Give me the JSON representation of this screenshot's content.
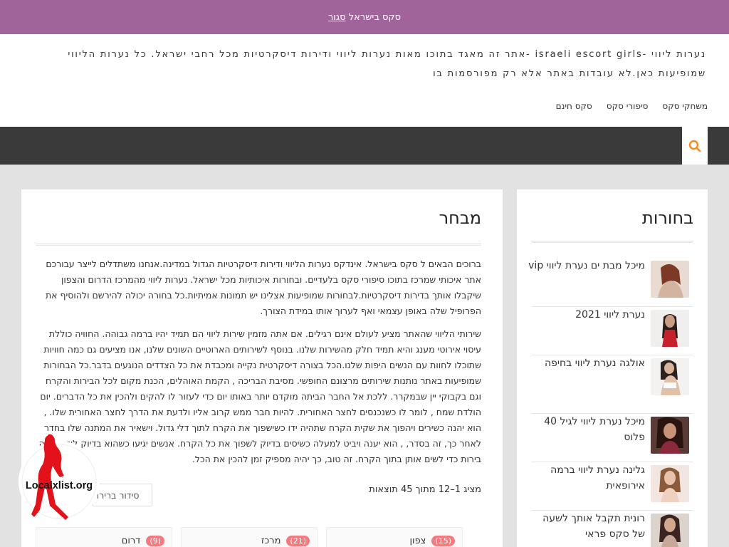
{
  "notice": {
    "text": "סקס בישראל",
    "close_label": "סגור"
  },
  "header": {
    "description": "נערות ליווי -israeli escort girls -אתר זה מאגד בתוכו מאות נערות ליווי ודירות דיסקרטיות מכל רחבי ישראל. כל נערות הליווי שמופיעות כאן.לא עובדות באתר אלא רק מפורסמות בו",
    "menu": [
      "משחקי סקס",
      "סיפורי סקס",
      "סקס חינם"
    ]
  },
  "colors": {
    "notice_bg": "#a0649b",
    "nav_bg": "#3a3a3a",
    "accent": "#f58a1f",
    "badge": "#f37a7f"
  },
  "icons": {
    "search": "search-icon"
  },
  "sidebar": {
    "title": "בחורות",
    "items": [
      {
        "label": "מיכל מבת ים נערת ליווי vip"
      },
      {
        "label": "נערת ליווי 2021"
      },
      {
        "label": "אולגה נערת ליווי בחיפה"
      },
      {
        "label": "מיכל נערת ליווי לגיל 40 פלוס"
      },
      {
        "label": "גלינה נערת ליווי ברמה אירופאית"
      },
      {
        "label": "רונית תקבל אותך לשעה של סקס פראי"
      }
    ]
  },
  "main": {
    "title": "מבחר",
    "para1": "ברוכים הבאים ל סקס בישראל. אינדקס נערות הליווי ודירות דיסקרטיות הגדול במדינה.אנחנו משתדלים לייצר עבורכם אתר איכותי שמרכז בתוכו סיפורי סקס בלעדיים. ובחורות איכותיות מכל ישראל. נערות ליווי מהמרכז הדרום והצפון שיקבלו אותך בדירות דיסקרטיות.לבחורות שמופיעות אצלינו יש תמונות אמיתיות.כל בחורה יכולה להירשם ולהוסיף את הפרופיל שלה באופן עצמאי ואף לערוך אותו במידת הצורך.",
    "para2": "שירותי הליווי שהאתר מציע  לעולם אינם רגילים. אם אתה מזמין שירות ליווי הם תמיד יהיו ברמה גבוהה. החוויה כוללת עיסוי אירוטי מענג והיא תמיד חלק מהשירות שלנו. בנוסף לשירותים הארוטיים השונים שלנו, אנו מציעים גם כמה חוויות שתוכלו לחוות עם הנשים היפות שלנו.הכל בצורה דיסקרטית נקייה ומכבדת את כל הצדדים הנוגעים בדבר.כל הבחורות שמופיעות באתר נותנות שירותים מרצונם החופשי. מסיבת הבריכה , הקמת האוהלים, הכנת מקום לכל הבירות והקרח וגם בקבוקי יין שבמקרר. ללכת אל החבר הביתה מוקדם יותר באותו יום כדי לעזור לו להקים ולהכין את כל הדברים. יום הולדת שמח , לומר לו כשנכנסים לחצר האחורית. להיות חבר ממש קרוב אליו ולדעת את הדרך לחצר האחורית שלו. , הוא יהנה כשירים ויהפוך את שקית הקרח שתהיה ידו כשישפוך את הקרח לתוך דלי גדול. וישאיר את המתנה שלו בחדר לאחר כך, זה בסדר, , הוא יענה ויביט למעלה כשיסים בדיוק לשפוך את כל הקרח. אנשים יגיעו כשהוא בדיוק לוקח כמה בירות כדי לשים אותן בתוך הקרח. זה טוב, כך יהיה מספיק זמן להכין את הכל.",
    "results": "מציג 1–12 מתוך 45 תוצאות",
    "sort_label": "סידור ברירת",
    "categories": [
      {
        "name": "צפון",
        "count": "(15)"
      },
      {
        "name": "מרכז",
        "count": "(21)"
      },
      {
        "name": "דרום",
        "count": "(9)"
      }
    ]
  },
  "logo": {
    "text": "Localxlist.org"
  }
}
